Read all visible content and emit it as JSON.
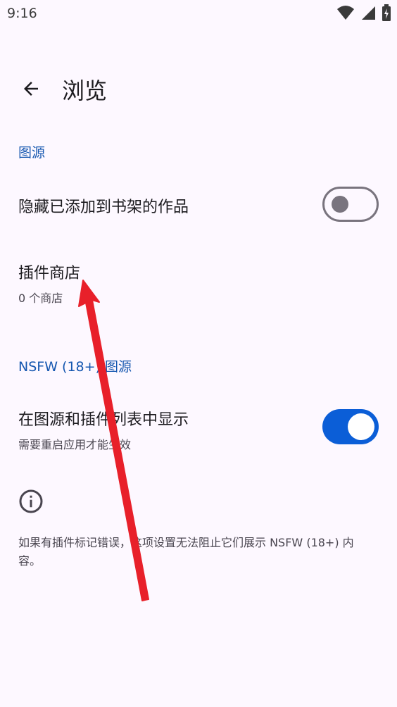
{
  "status_bar": {
    "time": "9:16",
    "icons": [
      "wifi-icon",
      "cell-signal-icon",
      "battery-icon"
    ]
  },
  "app_bar": {
    "title": "浏览",
    "back_icon": "arrow-back-icon"
  },
  "sections": {
    "sources": {
      "header": "图源",
      "hide_in_library": {
        "title": "隐藏已添加到书架的作品",
        "enabled": false
      },
      "extension_repos": {
        "title": "插件商店",
        "summary": "0 个商店"
      }
    },
    "nsfw": {
      "header": "NSFW (18+) 图源",
      "show_in_lists": {
        "title": "在图源和插件列表中显示",
        "summary": "需要重启应用才能生效",
        "enabled": true
      }
    }
  },
  "info": {
    "icon": "info-icon",
    "text": "如果有插件标记错误，这项设置无法阻止它们展示 NSFW (18+) 内容。"
  },
  "colors": {
    "background": "#fdf8ff",
    "accent": "#1557b0",
    "switch_on": "#0b5ed7",
    "annotation_arrow": "#e8202a"
  }
}
